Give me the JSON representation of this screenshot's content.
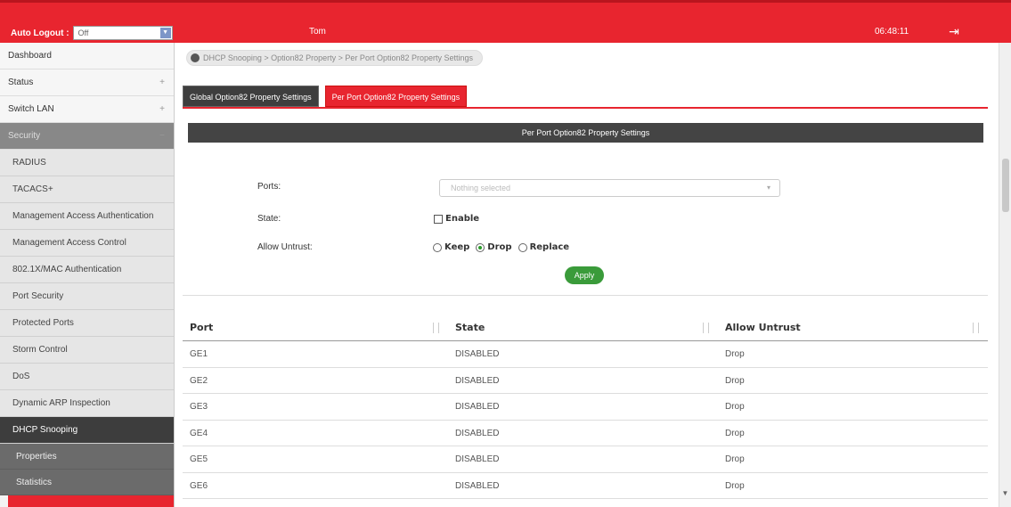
{
  "header": {
    "auto_logout_label": "Auto Logout :",
    "auto_logout_value": "Off",
    "user": "Tom",
    "time": "06:48:11"
  },
  "sidebar": {
    "items": [
      {
        "label": "Dashboard"
      },
      {
        "label": "Status"
      },
      {
        "label": "Switch LAN"
      },
      {
        "label": "Security"
      }
    ],
    "security_items": [
      {
        "label": "RADIUS"
      },
      {
        "label": "TACACS+"
      },
      {
        "label": "Management Access Authentication"
      },
      {
        "label": "Management Access Control"
      },
      {
        "label": "802.1X/MAC Authentication"
      },
      {
        "label": "Port Security"
      },
      {
        "label": "Protected Ports"
      },
      {
        "label": "Storm Control"
      },
      {
        "label": "DoS"
      },
      {
        "label": "Dynamic ARP Inspection"
      },
      {
        "label": "DHCP Snooping"
      }
    ],
    "dhcp_items": [
      {
        "label": "Properties"
      },
      {
        "label": "Statistics"
      }
    ]
  },
  "breadcrumb": "DHCP Snooping  >  Option82 Property  >  Per Port Option82 Property Settings",
  "tabs": {
    "global": "Global Option82 Property Settings",
    "perport": "Per Port Option82 Property Settings"
  },
  "section_title": "Per Port Option82 Property Settings",
  "form": {
    "ports_label": "Ports:",
    "ports_placeholder": "Nothing selected",
    "state_label": "State:",
    "state_option": "Enable",
    "untrust_label": "Allow Untrust:",
    "untrust_options": {
      "keep": "Keep",
      "drop": "Drop",
      "replace": "Replace"
    },
    "apply": "Apply"
  },
  "table": {
    "headers": {
      "port": "Port",
      "state": "State",
      "untrust": "Allow Untrust"
    },
    "rows": [
      {
        "port": "GE1",
        "state": "DISABLED",
        "untrust": "Drop"
      },
      {
        "port": "GE2",
        "state": "DISABLED",
        "untrust": "Drop"
      },
      {
        "port": "GE3",
        "state": "DISABLED",
        "untrust": "Drop"
      },
      {
        "port": "GE4",
        "state": "DISABLED",
        "untrust": "Drop"
      },
      {
        "port": "GE5",
        "state": "DISABLED",
        "untrust": "Drop"
      },
      {
        "port": "GE6",
        "state": "DISABLED",
        "untrust": "Drop"
      }
    ]
  },
  "colors": {
    "brand_red": "#e8252f",
    "dark": "#444444",
    "apply_green": "#3a9b3a"
  }
}
